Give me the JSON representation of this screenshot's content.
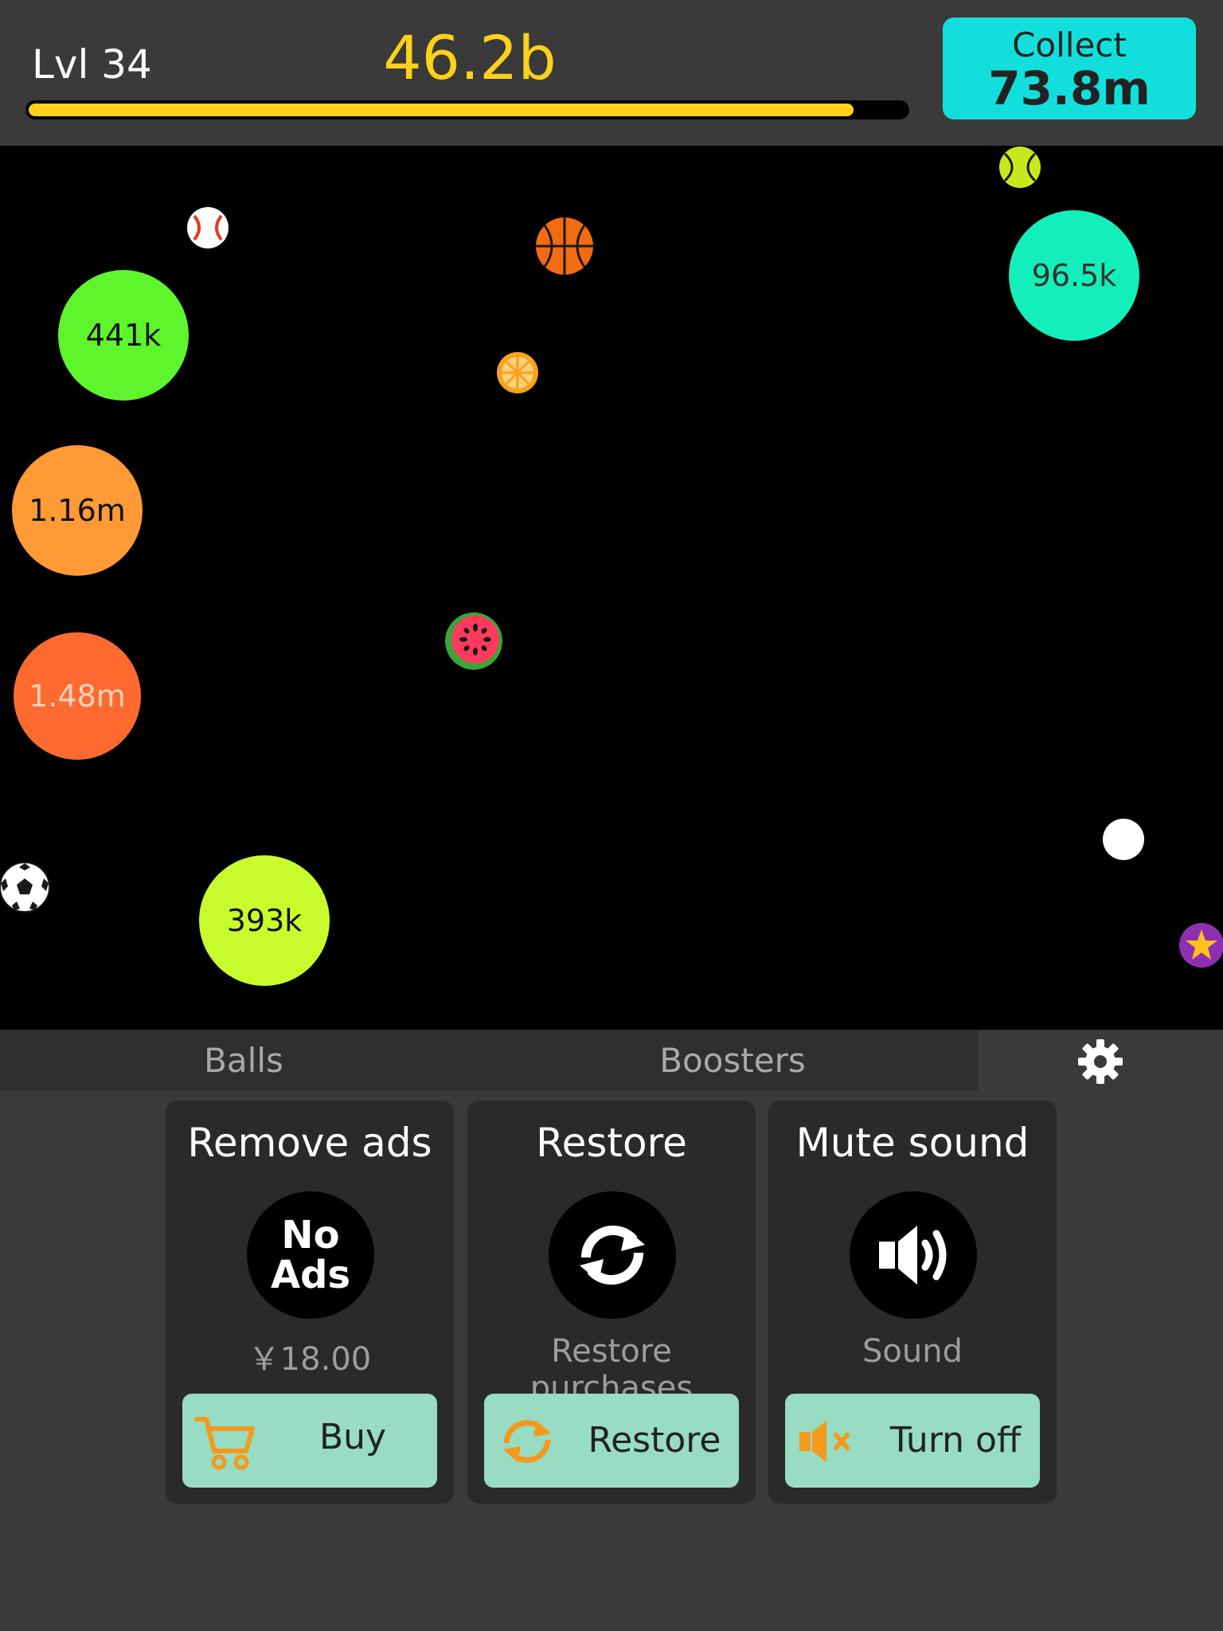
{
  "header": {
    "level": "Lvl 34",
    "money": "46.2b",
    "progress": 0.94,
    "collect_label": "Collect",
    "collect_amount": "73.8m"
  },
  "game": {
    "orbs": [
      {
        "value": "441k",
        "color": "#5ff52d"
      },
      {
        "value": "96.5k",
        "color": "#12efba"
      },
      {
        "value": "1.16m",
        "color": "#ff9a35"
      },
      {
        "value": "1.48m",
        "color": "#ff6a30"
      },
      {
        "value": "393k",
        "color": "#c8fb2c"
      }
    ],
    "balls": [
      "baseball-icon",
      "basketball-icon",
      "orange-slice-icon",
      "tennis-ball-icon",
      "watermelon-icon",
      "white-ball-icon",
      "soccer-ball-icon",
      "star-ball-icon"
    ]
  },
  "tabs": {
    "balls": "Balls",
    "boosters": "Boosters",
    "settings_icon": "gear-icon"
  },
  "cards": {
    "remove_ads": {
      "title": "Remove ads",
      "icon_line1": "No",
      "icon_line2": "Ads",
      "subtitle": "￥18.00",
      "button": "Buy",
      "button_icon": "cart-icon"
    },
    "restore": {
      "title": "Restore",
      "subtitle": "Restore purchases",
      "button": "Restore",
      "button_icon": "refresh-icon"
    },
    "mute": {
      "title": "Mute sound",
      "subtitle": "Sound",
      "button": "Turn off",
      "button_icon": "speaker-muted-icon"
    }
  },
  "colors": {
    "accent_yellow": "#ffd11a",
    "collect_cyan": "#12dfdc",
    "button_mint": "#97dcc3",
    "icon_orange": "#f39a1c"
  }
}
